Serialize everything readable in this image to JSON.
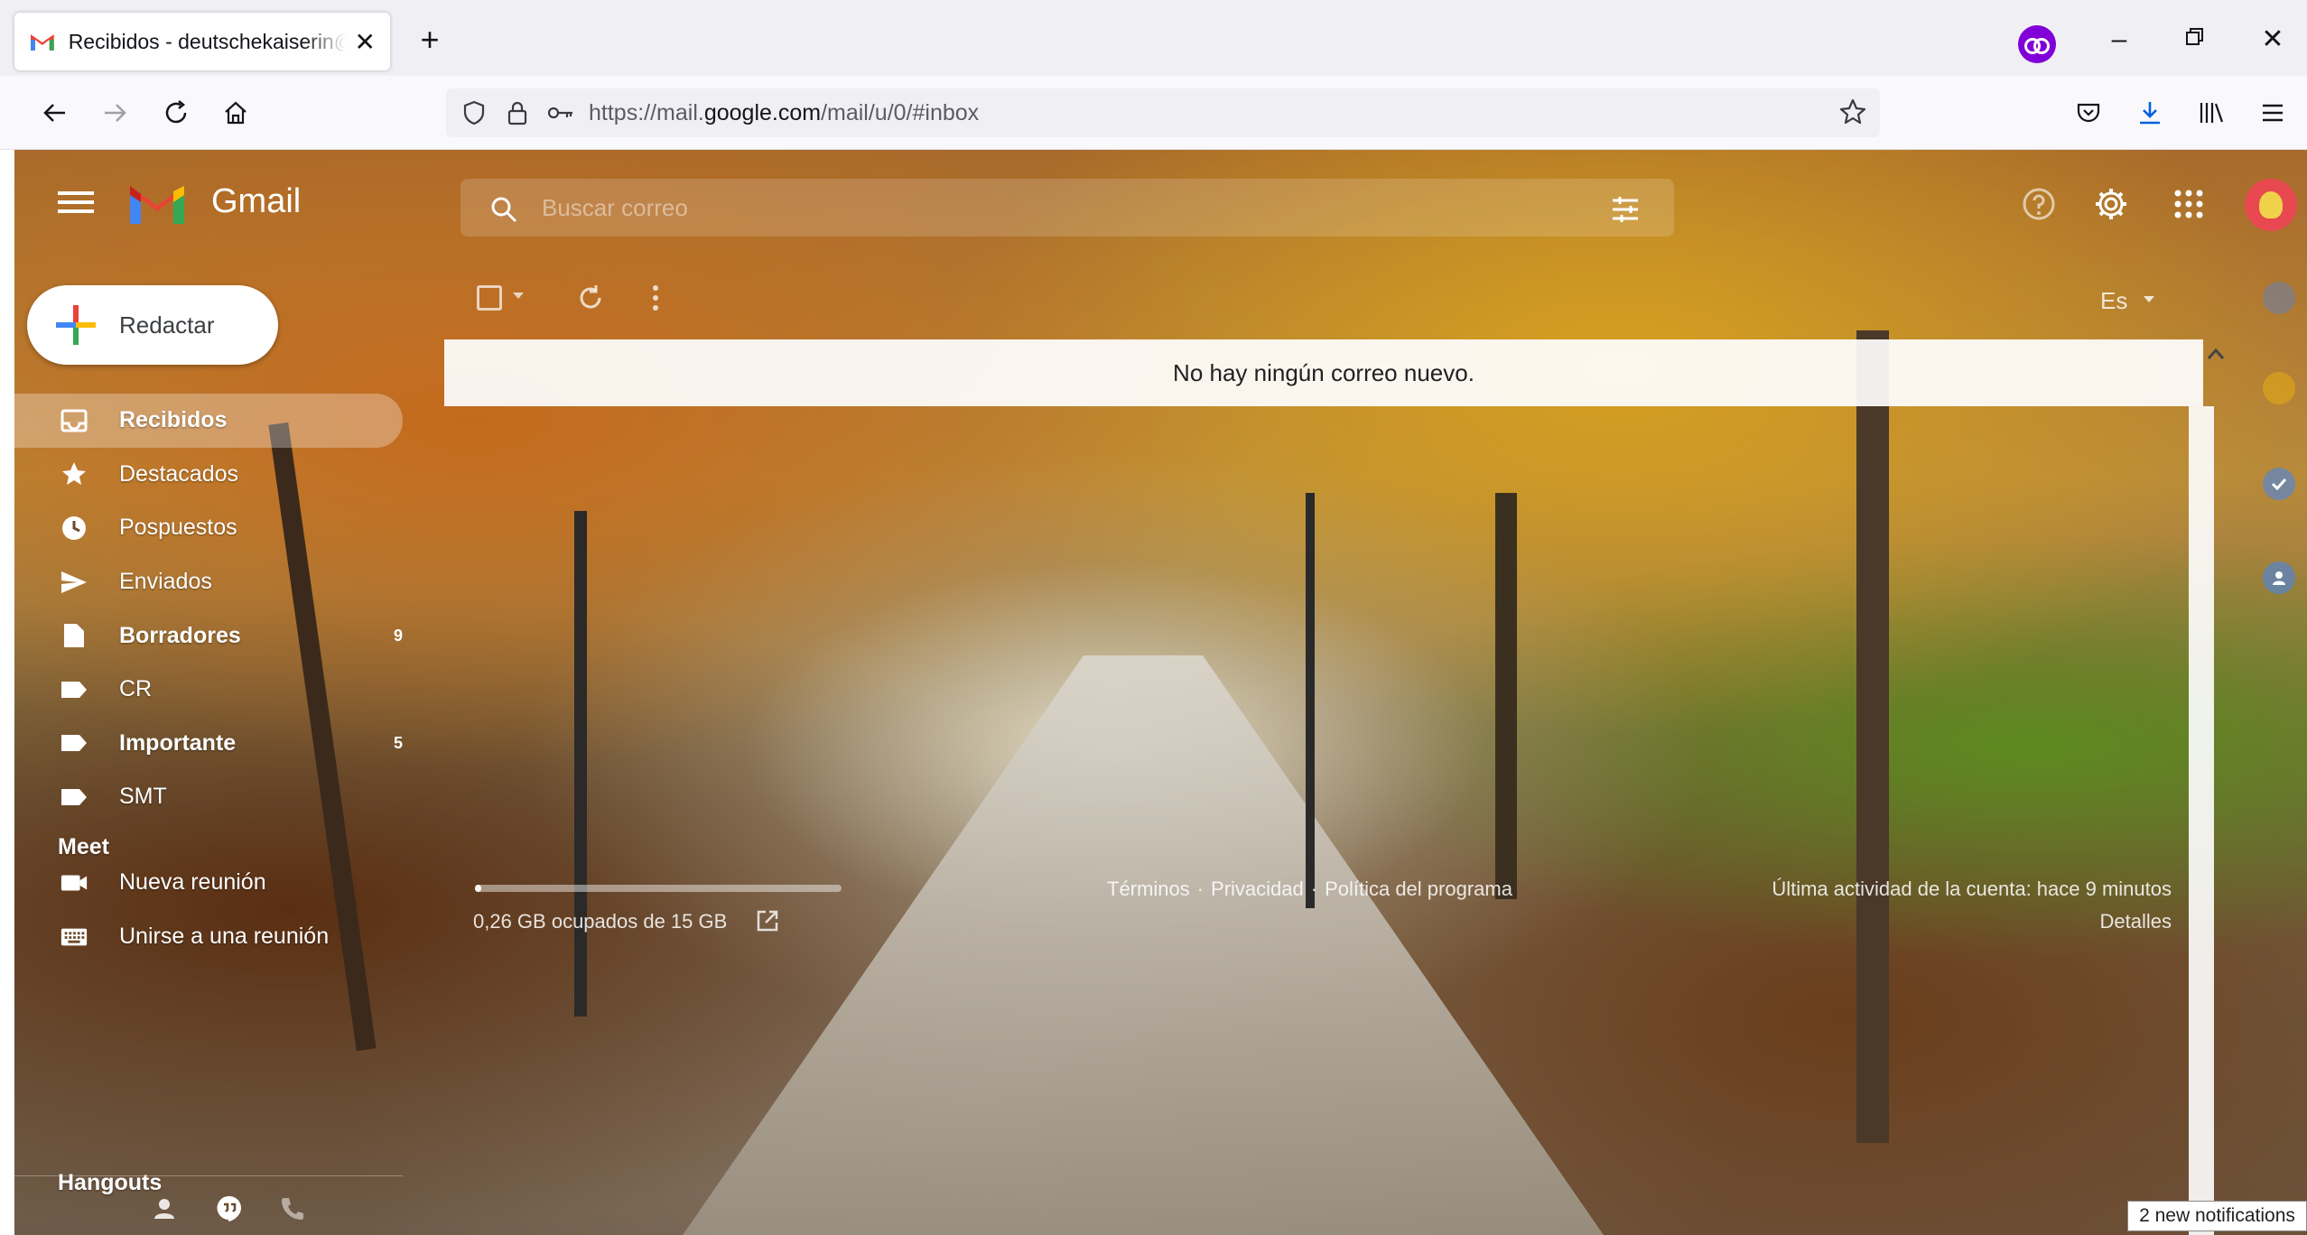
{
  "browser": {
    "tab_title": "Recibidos - deutschekaiserin@gmail.com - Gmail",
    "url_prefix": "https://mail.",
    "url_domain": "google.com",
    "url_suffix": "/mail/u/0/#inbox"
  },
  "gmail": {
    "logo_text": "Gmail",
    "search_placeholder": "Buscar correo",
    "compose_label": "Redactar",
    "nav": [
      {
        "label": "Recibidos",
        "icon": "inbox-icon",
        "bold": true,
        "active": true,
        "count": ""
      },
      {
        "label": "Destacados",
        "icon": "star-icon",
        "bold": false,
        "count": ""
      },
      {
        "label": "Pospuestos",
        "icon": "clock-icon",
        "bold": false,
        "count": ""
      },
      {
        "label": "Enviados",
        "icon": "send-icon",
        "bold": false,
        "count": ""
      },
      {
        "label": "Borradores",
        "icon": "draft-icon",
        "bold": true,
        "count": "9"
      },
      {
        "label": "CR",
        "icon": "label-icon",
        "bold": false,
        "count": ""
      },
      {
        "label": "Importante",
        "icon": "label-icon",
        "bold": true,
        "count": "5"
      },
      {
        "label": "SMT",
        "icon": "label-icon",
        "bold": false,
        "count": ""
      }
    ],
    "meet": {
      "title": "Meet",
      "new_meeting": "Nueva reunión",
      "join_meeting": "Unirse a una reunión"
    },
    "hangouts_title": "Hangouts",
    "language": "Es",
    "empty_message": "No hay ningún correo nuevo.",
    "storage_text": "0,26 GB ocupados de 15 GB",
    "storage_fraction": 0.017,
    "footer": {
      "terms": "Términos",
      "privacy": "Privacidad",
      "policy": "Política del programa",
      "separator": "·"
    },
    "last_activity": "Última actividad de la cuenta: hace 9 minutos",
    "details": "Detalles"
  },
  "notification": "2 new notifications",
  "colors": {
    "private_purple": "#8000d7",
    "download_blue": "#0060df",
    "avatar_red": "#e8484f"
  }
}
